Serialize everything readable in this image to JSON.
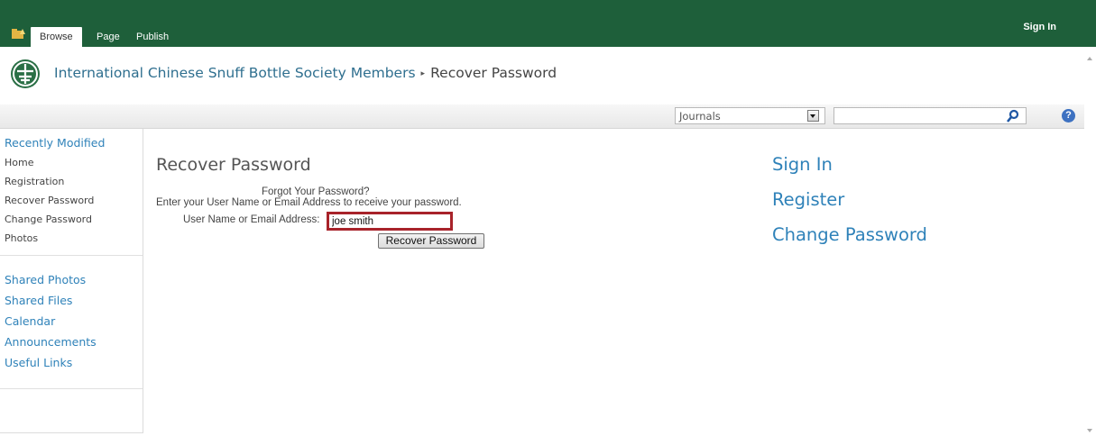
{
  "ribbon": {
    "tabs": [
      {
        "label": "Browse",
        "active": true
      },
      {
        "label": "Page",
        "active": false
      },
      {
        "label": "Publish",
        "active": false
      }
    ],
    "sign_in": "Sign In",
    "icon": "folder-up-icon"
  },
  "titlebar": {
    "site_name": "International Chinese Snuff Bottle Society Members",
    "separator": "▸",
    "page_name": "Recover Password",
    "logo_icon": "society-logo"
  },
  "search": {
    "scope": "Journals",
    "query": "",
    "search_icon": "search-icon",
    "help_icon_glyph": "?"
  },
  "leftnav": {
    "header": "Recently Modified",
    "links": [
      "Home",
      "Registration",
      "Recover Password",
      "Change Password",
      "Photos"
    ],
    "quicklaunch": [
      "Shared Photos",
      "Shared Files",
      "Calendar",
      "Announcements",
      "Useful Links"
    ]
  },
  "main": {
    "title": "Recover Password",
    "forgot": "Forgot Your Password?",
    "instructions": "Enter your User Name or Email Address to receive your password.",
    "field_label": "User Name or Email Address:",
    "field_value": "joe smith",
    "button_label": "Recover Password"
  },
  "right_links": [
    "Sign In",
    "Register",
    "Change Password"
  ],
  "colors": {
    "ribbon": "#1e5f3a",
    "link": "#2f82b9",
    "highlight": "#a8232a"
  }
}
